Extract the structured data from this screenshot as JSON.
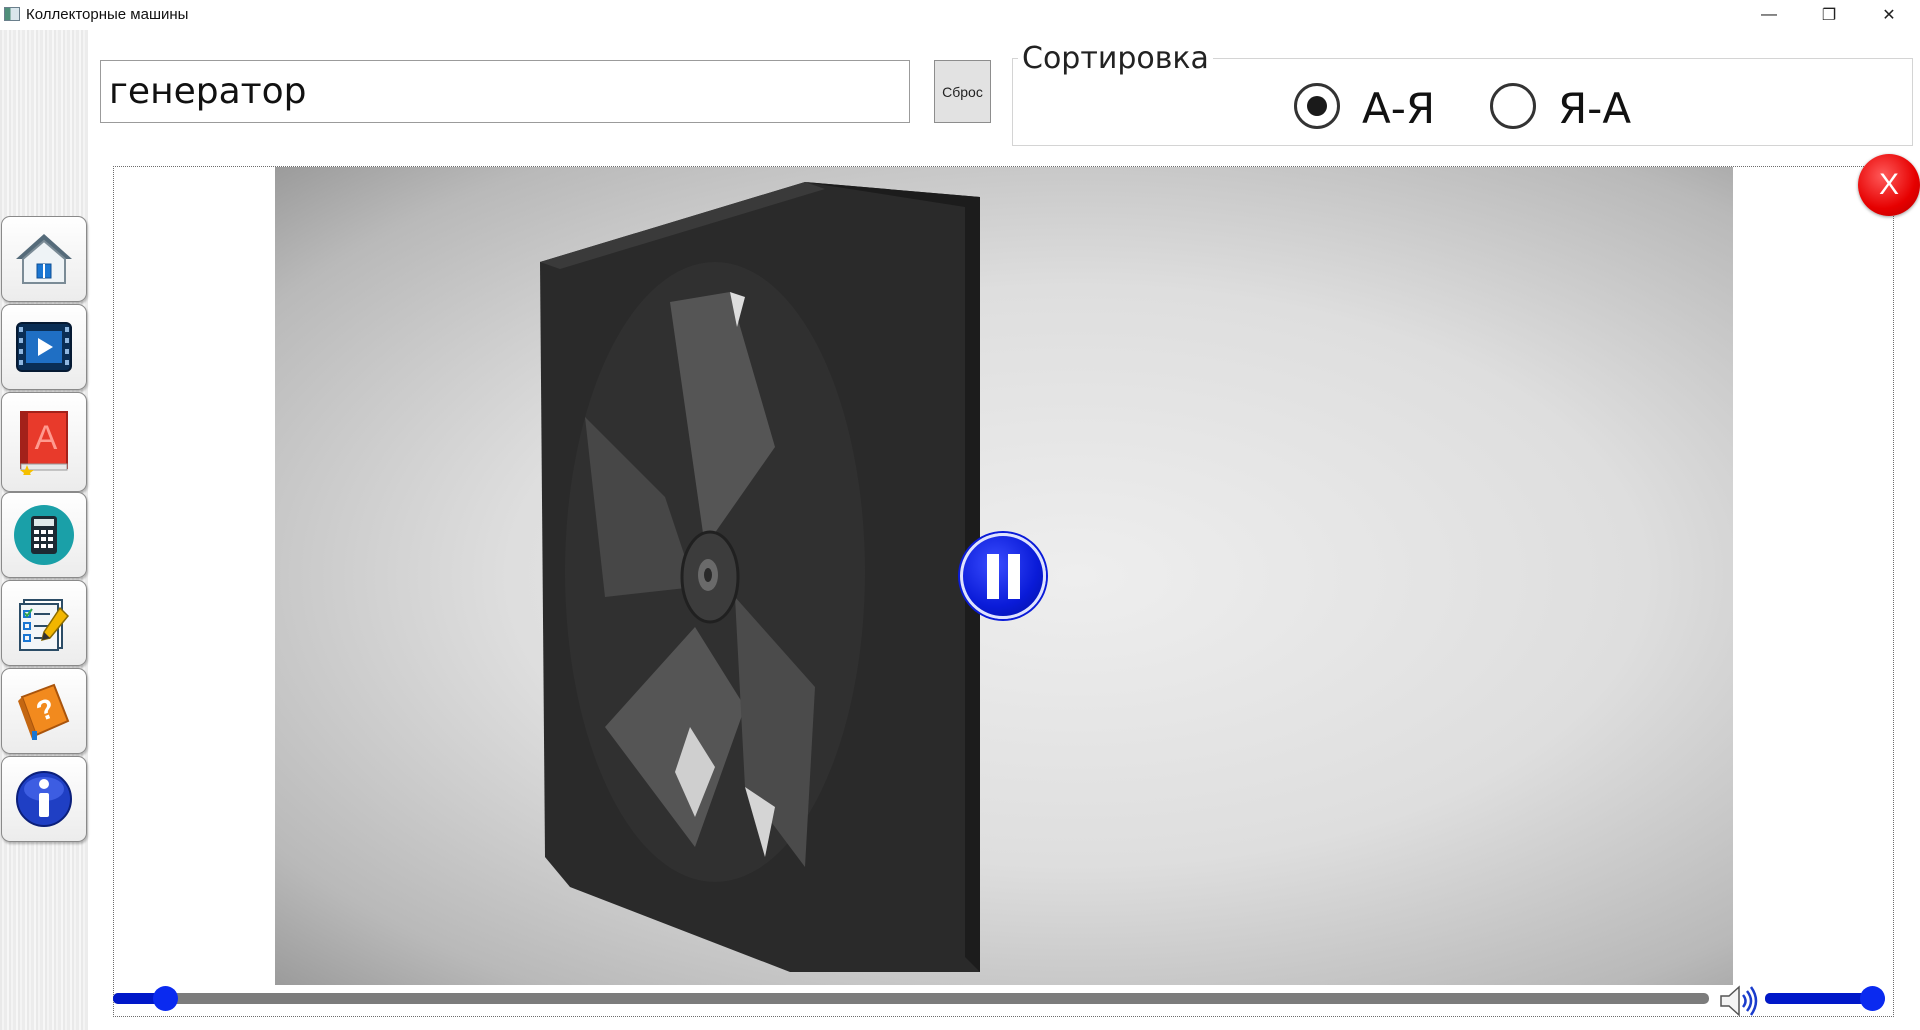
{
  "window": {
    "title": "Коллекторные машины",
    "minimize_glyph": "—",
    "maximize_glyph": "❐",
    "close_glyph": "✕"
  },
  "sidebar": {
    "items": [
      {
        "name": "home",
        "icon": "home-icon"
      },
      {
        "name": "video",
        "icon": "video-icon"
      },
      {
        "name": "dictionary",
        "icon": "book-icon"
      },
      {
        "name": "calculator",
        "icon": "calculator-icon"
      },
      {
        "name": "tests",
        "icon": "checklist-icon"
      },
      {
        "name": "help",
        "icon": "help-book-icon"
      },
      {
        "name": "info",
        "icon": "info-icon"
      }
    ]
  },
  "search": {
    "value": "генератор",
    "reset_label": "Сброс"
  },
  "sort": {
    "legend": "Сортировка",
    "options": [
      {
        "label": "А-Я",
        "checked": true
      },
      {
        "label": "Я-А",
        "checked": false
      }
    ]
  },
  "player": {
    "close_label": "X",
    "state": "playing",
    "progress": 0.025,
    "volume": 1.0
  },
  "colors": {
    "accent_blue": "#0a1bd8",
    "close_red": "#e60000"
  }
}
